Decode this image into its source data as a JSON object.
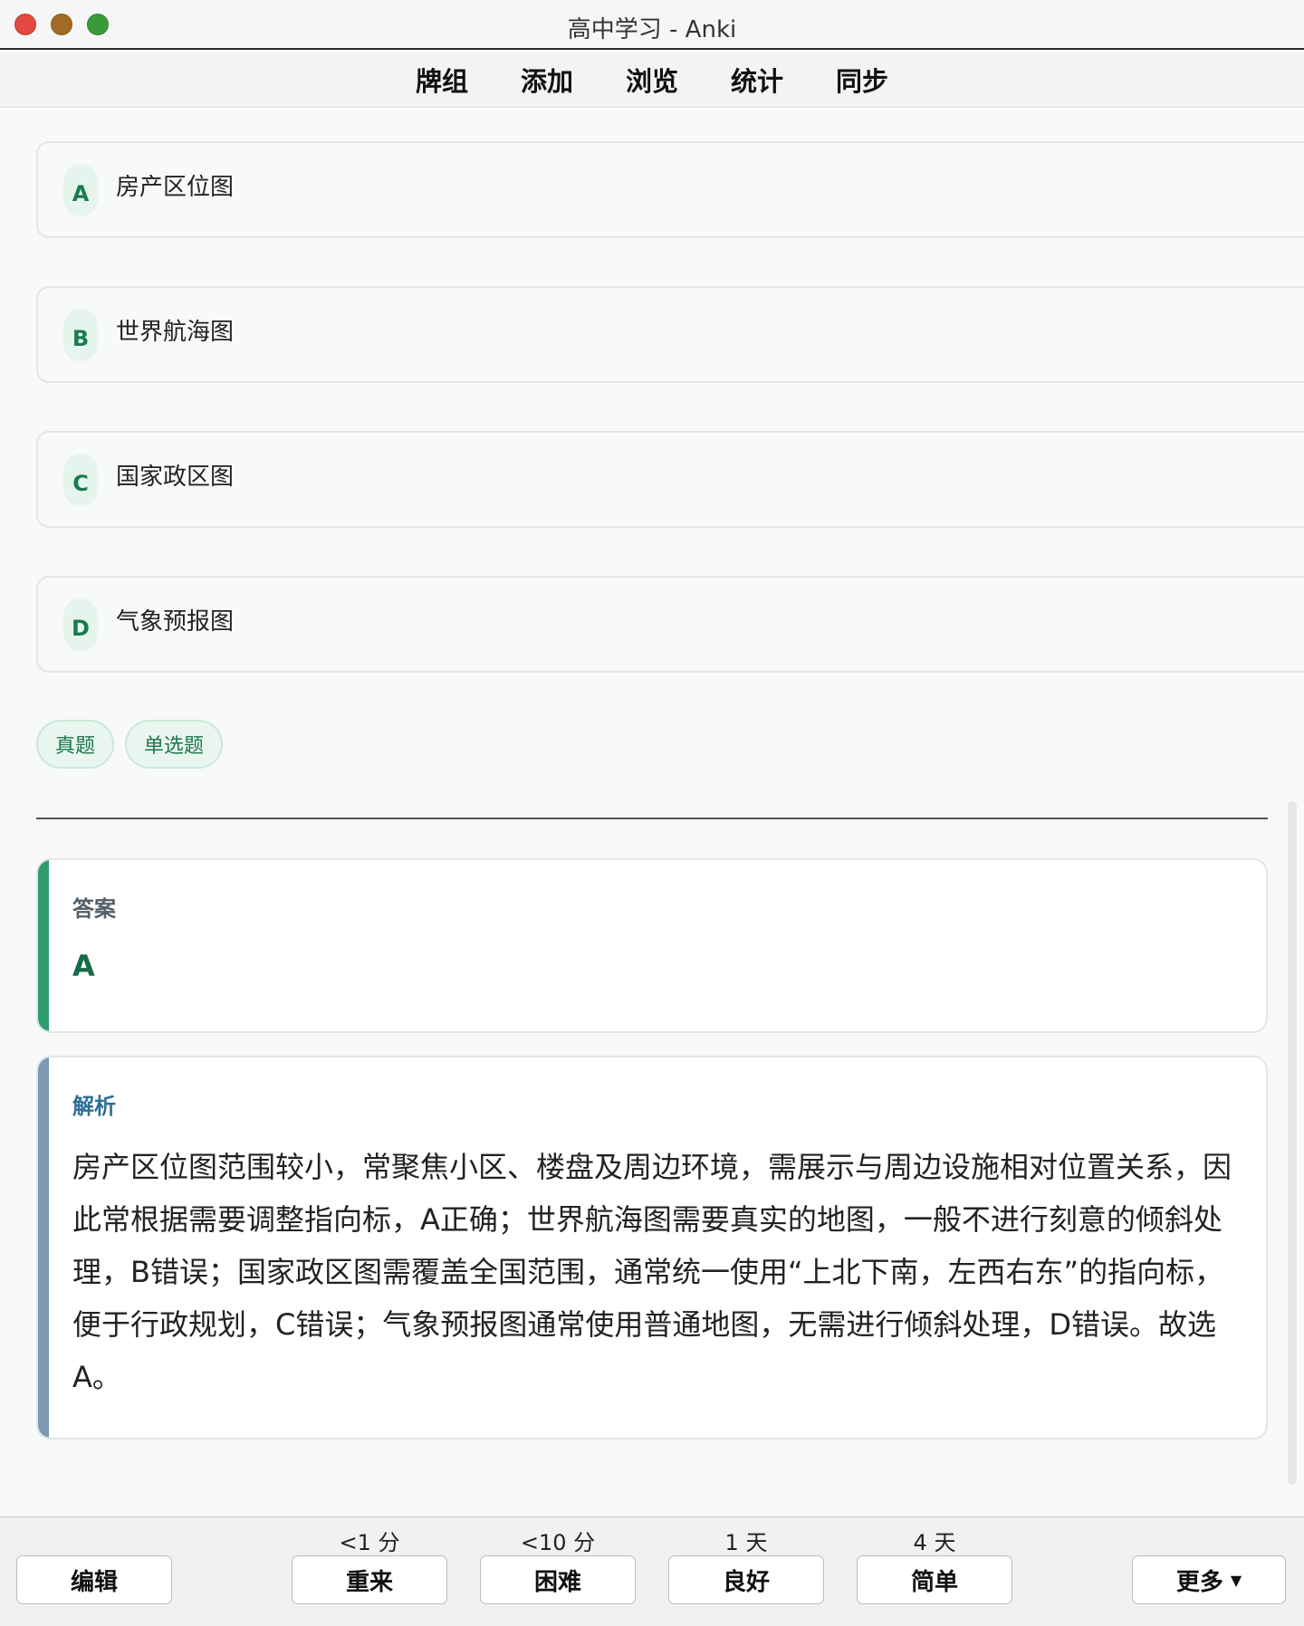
{
  "window": {
    "title": "高中学习 - Anki"
  },
  "nav": {
    "items": [
      "牌组",
      "添加",
      "浏览",
      "统计",
      "同步"
    ]
  },
  "options": [
    {
      "letter": "A",
      "text": "房产区位图"
    },
    {
      "letter": "B",
      "text": "世界航海图"
    },
    {
      "letter": "C",
      "text": "国家政区图"
    },
    {
      "letter": "D",
      "text": "气象预报图"
    }
  ],
  "tags": [
    "真题",
    "单选题"
  ],
  "answer": {
    "label": "答案",
    "value": "A"
  },
  "analysis": {
    "label": "解析",
    "text": "房产区位图范围较小，常聚焦小区、楼盘及周边环境，需展示与周边设施相对位置关系，因此常根据需要调整指向标，A正确；世界航海图需要真实的地图，一般不进行刻意的倾斜处理，B错误；国家政区图需覆盖全国范围，通常统一使用“上北下南，左西右东”的指向标，便于行政规划，C错误；气象预报图通常使用普通地图，无需进行倾斜处理，D错误。故选A。"
  },
  "bottom": {
    "edit_label": "编辑",
    "more_label": "更多",
    "more_icon": "chevron-down-icon",
    "ratings": [
      {
        "label": "重来",
        "interval": "<1 分"
      },
      {
        "label": "困难",
        "interval": "<10 分"
      },
      {
        "label": "良好",
        "interval": "1 天"
      },
      {
        "label": "简单",
        "interval": "4 天"
      }
    ]
  },
  "colors": {
    "accent_green": "#2f9e6e",
    "accent_blue": "#7c9bb2",
    "badge_text": "#1a7a52"
  }
}
